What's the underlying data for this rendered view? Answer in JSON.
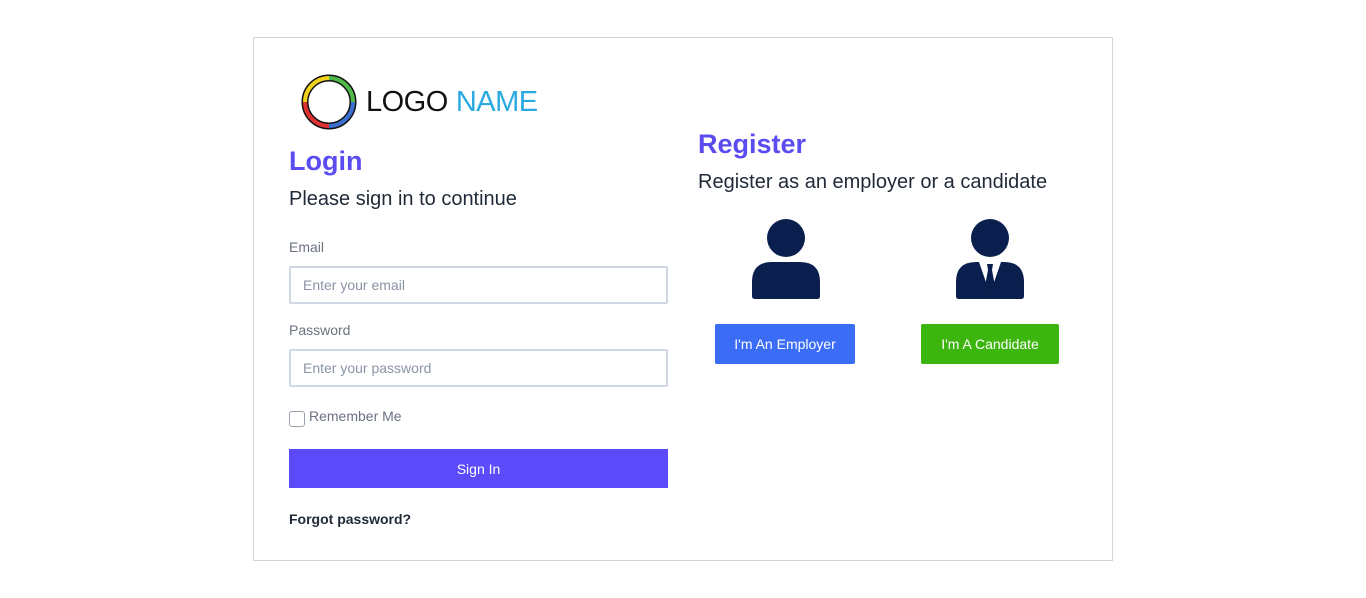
{
  "logo": {
    "word1": "LOGO",
    "word2": "NAME"
  },
  "login": {
    "title": "Login",
    "subtitle": "Please sign in to continue",
    "email_label": "Email",
    "email_placeholder": "Enter your email",
    "email_value": "",
    "password_label": "Password",
    "password_placeholder": "Enter your password",
    "password_value": "",
    "remember_label": "Remember Me",
    "remember_checked": false,
    "signin_label": "Sign In",
    "forgot_label": "Forgot password?"
  },
  "register": {
    "title": "Register",
    "subtitle": "Register as an employer or a candidate",
    "employer_icon": "person-icon",
    "candidate_icon": "person-with-tie-icon",
    "employer_label": "I'm An Employer",
    "candidate_label": "I'm A Candidate"
  },
  "colors": {
    "accent": "#5a4cf0",
    "signin": "#5b4bfa",
    "employer": "#3b6cf6",
    "candidate": "#3cb50f",
    "icon": "#0b1f4f",
    "logo_blue": "#29a9e1"
  }
}
